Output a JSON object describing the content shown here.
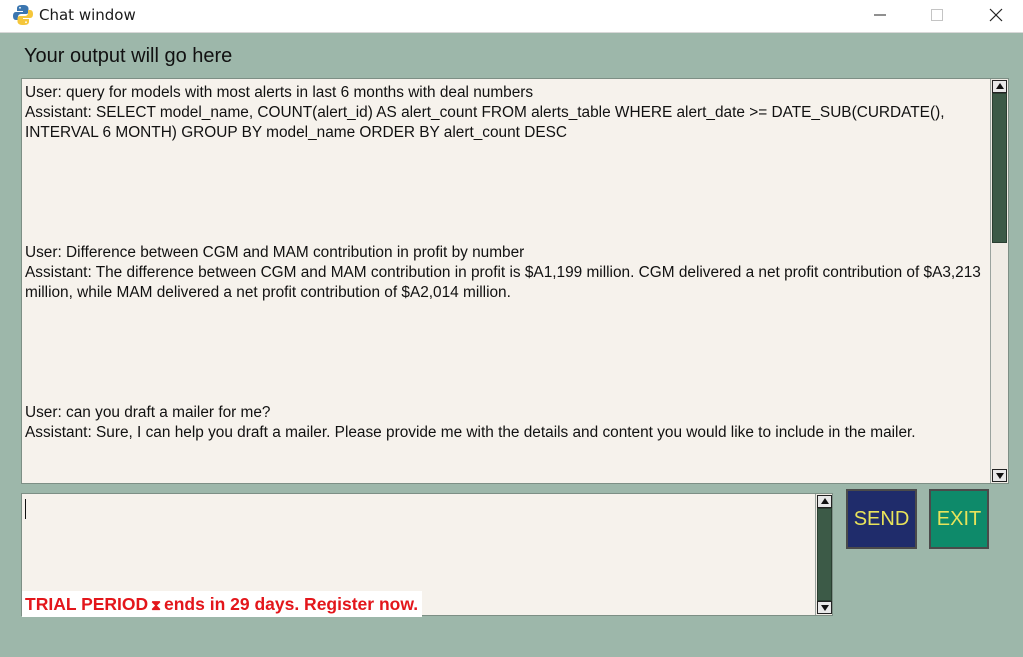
{
  "window": {
    "title": "Chat window",
    "controls": [
      "minimize",
      "maximize",
      "close"
    ]
  },
  "output": {
    "label": "Your output will go here",
    "messages": [
      {
        "user": "User: query for models with most alerts in last 6 months with deal numbers",
        "assistant": "Assistant: SELECT model_name, COUNT(alert_id) AS alert_count FROM alerts_table WHERE alert_date >= DATE_SUB(CURDATE(), INTERVAL 6 MONTH) GROUP BY model_name ORDER BY alert_count DESC"
      },
      {
        "user": "User: Difference between CGM and MAM contribution in profit by number",
        "assistant": "Assistant: The difference between CGM and MAM contribution in profit is $A1,199 million. CGM delivered a net profit contribution of $A3,213 million, while MAM delivered a net profit contribution of $A2,014 million."
      },
      {
        "user": "User: can you draft a mailer for me?",
        "assistant": "Assistant: Sure, I can help you draft a mailer. Please provide me with the details and content you would like to include in the mailer."
      }
    ]
  },
  "input": {
    "value": "",
    "placeholder": ""
  },
  "buttons": {
    "send": "SEND",
    "exit": "EXIT"
  },
  "trial": {
    "prefix": "TRIAL PERIOD",
    "hourglass_icon": "⧗",
    "suffix": "ends in 29 days. Register now."
  },
  "colors": {
    "body_background": "#9db7aa",
    "send_button": "#1f2c6b",
    "exit_button": "#0e8a6a",
    "button_text": "#e8e35a",
    "trial_text": "#e3161b",
    "scroll_thumb": "#3c5a47"
  }
}
